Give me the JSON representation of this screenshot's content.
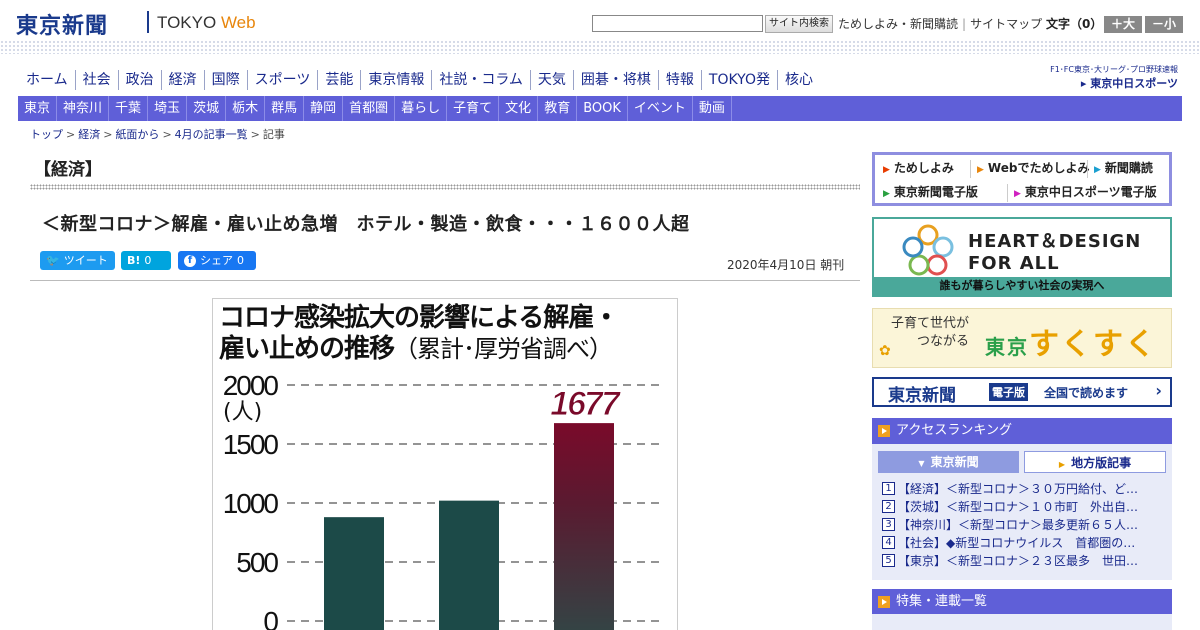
{
  "header": {
    "logo_ja": "東京新聞",
    "logo_en": "TOKYO",
    "logo_web": "Web",
    "search_button": "サイト内検索",
    "links": [
      "ためしよみ・新聞購読",
      "サイトマップ"
    ],
    "font_size_label": "文字（0）",
    "font_larger": "＋大",
    "font_smaller": "－小"
  },
  "nav_main": [
    "ホーム",
    "社会",
    "政治",
    "経済",
    "国際",
    "スポーツ",
    "芸能",
    "東京情報",
    "社説・コラム",
    "天気",
    "囲碁・将棋",
    "特報",
    "TOKYO発",
    "核心"
  ],
  "chunichi": {
    "small": "F1･FC東京･大リーグ･プロ野球速報",
    "big": "東京中日スポーツ"
  },
  "nav_region": [
    "東京",
    "神奈川",
    "千葉",
    "埼玉",
    "茨城",
    "栃木",
    "群馬",
    "静岡",
    "首都圏",
    "暮らし",
    "子育て",
    "文化",
    "教育",
    "BOOK",
    "イベント",
    "動画"
  ],
  "breadcrumb": [
    "トップ",
    "経済",
    "紙面から",
    "4月の記事一覧",
    "記事"
  ],
  "article": {
    "section": "【経済】",
    "headline": "＜新型コロナ＞解雇・雇い止め急増　ホテル・製造・飲食・・・１６００人超",
    "date": "2020年4月10日 朝刊",
    "share_tweet": "ツイート",
    "share_hatena": "B!",
    "share_hatena_count": "0",
    "share_fb": "シェア",
    "share_fb_count": "0"
  },
  "chart_title": {
    "line1": "コロナ感染拡大の影響による解雇・",
    "line2": "雇い止めの推移",
    "line2_paren": "（累計･厚労省調べ）"
  },
  "chart_data": {
    "type": "bar",
    "title": "コロナ感染拡大の影響による解雇・雇い止めの推移（累計･厚労省調べ）",
    "ylabel": "(人)",
    "ylim": [
      0,
      2000
    ],
    "yticks": [
      0,
      500,
      1000,
      1500,
      2000
    ],
    "grid": "dashed-horizontal",
    "values": [
      880,
      1020,
      1677
    ],
    "labeled_value": "1677",
    "colors": {
      "bar": "#1c4a48",
      "highlight_top": "#7a0a2a",
      "highlight_bottom": "#2e4a48"
    }
  },
  "sidebar": {
    "quick_links": [
      "ためしよみ",
      "Webでためしよみ",
      "新聞購読",
      "東京新聞電子版",
      "東京中日スポーツ電子版"
    ],
    "banner_hd_line1": "HEART＆DESIGN",
    "banner_hd_line2": "FOR ALL",
    "banner_hd_foot": "誰もが暮らしやすい社会の実現へ",
    "banner_sk_small1": "子育て世代が",
    "banner_sk_small2": "つながる",
    "banner_sk_tokyo": "東京",
    "banner_sk_big": "すくすく",
    "banner_ep_logo": "東京新聞",
    "banner_ep_tag": "電子版",
    "banner_ep_text": "全国で読めます",
    "ranking_title": "アクセスランキング",
    "ranking_tab_on": "東京新聞",
    "ranking_tab_off": "地方版記事",
    "ranking": [
      "【経済】＜新型コロナ＞３０万円給付、ど…",
      "【茨城】＜新型コロナ＞１０市町　外出自…",
      "【神奈川】＜新型コロナ＞最多更新６５人…",
      "【社会】◆新型コロナウイルス　首都圏の…",
      "【東京】＜新型コロナ＞２３区最多　世田…"
    ],
    "feature_title": "特集・連載一覧"
  }
}
